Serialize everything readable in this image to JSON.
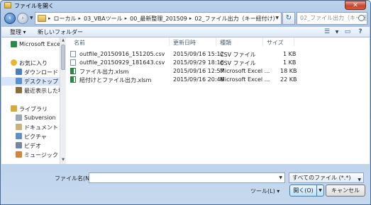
{
  "window": {
    "title": "ファイルを開く",
    "close_label": "✕"
  },
  "address": {
    "breadcrumbs": [
      "ローカル",
      "03_VBAツール",
      "00_最新整理_201509",
      "02_ファイル出力（キー紐付け）"
    ],
    "separator": "▸",
    "search_placeholder": "02_ファイル出力（キー紐付け..."
  },
  "toolbar": {
    "organize": "整理 ▾",
    "new_folder": "新しいフォルダー"
  },
  "sidebar": {
    "items": [
      {
        "label": "Microsoft Excel",
        "icon": "excel-icon",
        "color": "#2a8a45"
      },
      {
        "label": "お気に入り",
        "icon": "star-icon",
        "color": "#e9b52f"
      },
      {
        "label": "ダウンロード",
        "icon": "download-icon",
        "color": "#4a7fc1"
      },
      {
        "label": "デスクトップ",
        "icon": "desktop-icon",
        "color": "#5a8fd0"
      },
      {
        "label": "最近表示した場所",
        "icon": "recent-icon",
        "color": "#8a6d3b"
      },
      {
        "label": "ライブラリ",
        "icon": "library-icon",
        "color": "#d9a93a"
      },
      {
        "label": "Subversion",
        "icon": "subversion-icon",
        "color": "#9aa7b8"
      },
      {
        "label": "ドキュメント",
        "icon": "documents-icon",
        "color": "#c9b27a"
      },
      {
        "label": "ピクチャ",
        "icon": "pictures-icon",
        "color": "#5d8fc7"
      },
      {
        "label": "ビデオ",
        "icon": "video-icon",
        "color": "#7a8696"
      },
      {
        "label": "ミュージック",
        "icon": "music-icon",
        "color": "#d1843a"
      }
    ]
  },
  "filelist": {
    "columns": [
      "名前",
      "更新日時",
      "種類",
      "サイズ"
    ],
    "rows": [
      {
        "name": "outfile_20150916_151205.csv",
        "date": "2015/09/16 15:12",
        "type": "CSV ファイル",
        "size": "1 KB",
        "icon": "csv-file-icon"
      },
      {
        "name": "outfile_20150929_181643.csv",
        "date": "2015/09/29 18:16",
        "type": "CSV ファイル",
        "size": "1 KB",
        "icon": "csv-file-icon"
      },
      {
        "name": "ファイル出力.xlsm",
        "date": "2015/09/16 12:57",
        "type": "Microsoft Excel ...",
        "size": "18 KB",
        "icon": "excel-file-icon"
      },
      {
        "name": "紐付けとファイル出力.xlsm",
        "date": "2015/09/16 20:46",
        "type": "Microsoft Excel ...",
        "size": "22 KB",
        "icon": "excel-file-icon"
      }
    ]
  },
  "bottom": {
    "filename_label": "ファイル名(N):",
    "filename_value": "",
    "filter_value": "すべてのファイル (*.*)",
    "tools_label": "ツール(L) ▾",
    "open_label": "開く(O)",
    "cancel_label": "キャンセル"
  }
}
